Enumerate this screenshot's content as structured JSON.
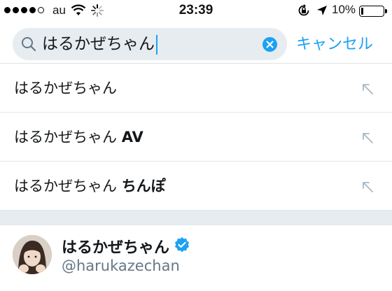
{
  "status_bar": {
    "carrier": "au",
    "time": "23:39",
    "battery_percent": "10%",
    "battery_level": 0.1
  },
  "search": {
    "value": "はるかぜちゃん",
    "cancel_label": "キャンセル"
  },
  "suggestions": [
    {
      "base": "はるかぜちゃん",
      "extra": ""
    },
    {
      "base": "はるかぜちゃん ",
      "extra": "AV"
    },
    {
      "base": "はるかぜちゃん ",
      "extra": "ちんぽ"
    }
  ],
  "user_result": {
    "name": "はるかぜちゃん",
    "handle": "@harukazechan",
    "verified": true
  },
  "colors": {
    "accent": "#1da1f2",
    "search_bg": "#e6ecf0",
    "handle": "#657786"
  },
  "icons": {
    "search": "search-icon",
    "clear": "clear-icon",
    "suggestion_arrow": "arrow-up-left-icon",
    "verified": "verified-badge-icon"
  }
}
